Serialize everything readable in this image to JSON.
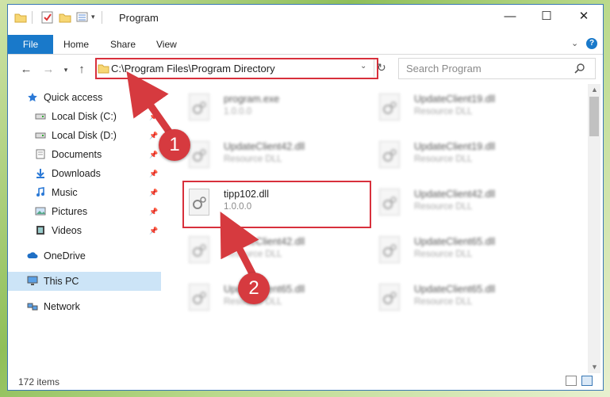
{
  "window": {
    "title": "Program"
  },
  "ribbon": {
    "tabs": [
      "File",
      "Home",
      "Share",
      "View"
    ]
  },
  "address": {
    "path": "C:\\Program Files\\Program Directory"
  },
  "search": {
    "placeholder": "Search Program"
  },
  "nav": {
    "items": [
      {
        "label": "Quick access",
        "icon": "star-icon",
        "pinned": false
      },
      {
        "label": "Local Disk (C:)",
        "icon": "drive-icon",
        "pinned": true
      },
      {
        "label": "Local Disk (D:)",
        "icon": "drive-icon",
        "pinned": true
      },
      {
        "label": "Documents",
        "icon": "documents-icon",
        "pinned": true
      },
      {
        "label": "Downloads",
        "icon": "download-arrow-icon",
        "pinned": true
      },
      {
        "label": "Music",
        "icon": "music-note-icon",
        "pinned": true
      },
      {
        "label": "Pictures",
        "icon": "pictures-icon",
        "pinned": true
      },
      {
        "label": "Videos",
        "icon": "film-icon",
        "pinned": true
      },
      {
        "label": "OneDrive",
        "icon": "cloud-icon",
        "pinned": false
      },
      {
        "label": "This PC",
        "icon": "monitor-icon",
        "pinned": false,
        "selected": true
      },
      {
        "label": "Network",
        "icon": "network-icon",
        "pinned": false
      }
    ]
  },
  "files": {
    "left": [
      {
        "name": "program.exe",
        "desc": "1.0.0.0",
        "highlight": false
      },
      {
        "name": "UpdateClient42.dll",
        "desc": "Resource DLL",
        "highlight": false
      },
      {
        "name": "tipp102.dll",
        "desc": "1.0.0.0",
        "highlight": true
      },
      {
        "name": "UpdateClient42.dll",
        "desc": "Resource DLL",
        "highlight": false
      },
      {
        "name": "UpdateClient65.dll",
        "desc": "Resource DLL",
        "highlight": false
      }
    ],
    "right": [
      {
        "name": "UpdateClient19.dll",
        "desc": "Resource DLL"
      },
      {
        "name": "UpdateClient19.dll",
        "desc": "Resource DLL"
      },
      {
        "name": "UpdateClient42.dll",
        "desc": "Resource DLL"
      },
      {
        "name": "UpdateClient65.dll",
        "desc": "Resource DLL"
      },
      {
        "name": "UpdateClient65.dll",
        "desc": "Resource DLL"
      }
    ]
  },
  "status": {
    "items_count": "172 items"
  },
  "annotations": {
    "badge1": "1",
    "badge2": "2"
  },
  "colors": {
    "accent": "#1979ca",
    "highlight_red": "#d8303c",
    "selection": "#cce4f7"
  }
}
